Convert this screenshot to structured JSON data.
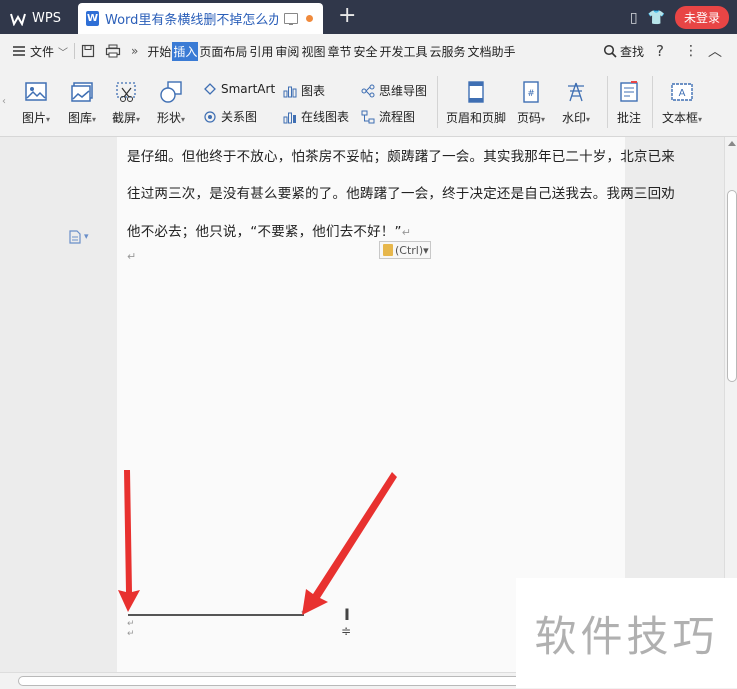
{
  "titlebar": {
    "app_name": "WPS",
    "doc_tab_title": "Word里有条横线删不掉怎么办",
    "login_label": "未登录"
  },
  "menubar": {
    "file_label": "文件",
    "more_label": "»",
    "tabs": [
      "开始",
      "插入",
      "页面布局",
      "引用",
      "审阅",
      "视图",
      "章节",
      "安全",
      "开发工具",
      "云服务",
      "文档助手"
    ],
    "active_tab": "插入",
    "search_label": "查找",
    "help_label": "?",
    "more_icon": "⋮",
    "collapse_icon": "︿"
  },
  "ribbon": {
    "picture_label": "图片",
    "gallery_label": "图库",
    "screenshot_label": "截屏",
    "shape_label": "形状",
    "smartart_label": "SmartArt",
    "chart_label": "图表",
    "mindmap_label": "思维导图",
    "relation_label": "关系图",
    "online_chart_label": "在线图表",
    "flowchart_label": "流程图",
    "header_footer_label": "页眉和页脚",
    "page_number_label": "页码",
    "watermark_label": "水印",
    "comment_label": "批注",
    "textbox_label": "文本框",
    "dropdown_mark": "▾"
  },
  "document": {
    "line1": "是仔细。但他终于不放心，怕茶房不妥帖；颇踌躇了一会。其实我那年已二十岁，北京已来",
    "line2": "往过两三次，是没有甚么要紧的了。他踌躇了一会，终于决定还是自己送我去。我两三回劝",
    "line3": "他不必去；他只说，“不要紧，他们去不好！”",
    "paragraph_mark": "↵",
    "paste_options_label": "(Ctrl)▾"
  },
  "watermark_text": "软件技巧",
  "colors": {
    "titlebar_bg": "#30374a",
    "active_tab_bg": "#3a7bd5",
    "login_bg": "#e84545",
    "arrow_red": "#e8312f"
  }
}
